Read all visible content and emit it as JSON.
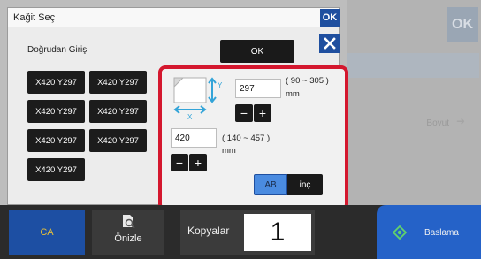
{
  "dialog": {
    "title": "Kağit Seç",
    "top_ok": "OK",
    "direct_entry_label": "Doğrudan Giriş",
    "ok_label": "OK"
  },
  "presets": [
    "X420 Y297",
    "X420 Y297",
    "X420 Y297",
    "X420 Y297",
    "X420 Y297",
    "X420 Y297",
    "X420 Y297"
  ],
  "custom_size": {
    "y_axis_label": "Y",
    "x_axis_label": "X",
    "y_value": "297",
    "y_range": "( 90 ~ 305 )",
    "y_unit": "mm",
    "x_value": "420",
    "x_range": "( 140 ~ 457 )",
    "x_unit": "mm",
    "minus": "−",
    "plus": "+",
    "unit_ab": "AB",
    "unit_inch": "inç"
  },
  "background": {
    "ok": "OK",
    "faded_text": "Bovut",
    "arrow": "➜"
  },
  "bottom_bar": {
    "ca": "CA",
    "preview": "Önizle",
    "copies_label": "Kopyalar",
    "copies_value": "1",
    "start": "Baslama"
  },
  "colors": {
    "accent_blue": "#1f4f9f",
    "highlight_red": "#d4172e",
    "start_blue": "#2562c8",
    "ca_yellow": "#e6c03a"
  }
}
